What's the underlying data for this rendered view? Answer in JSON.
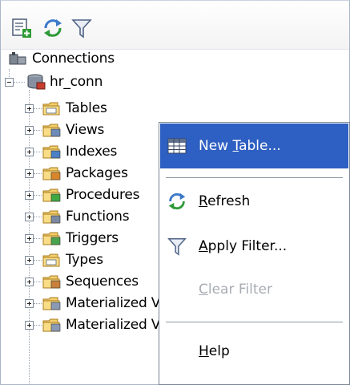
{
  "toolbar": {
    "buttons": [
      {
        "icon": "new-connection-icon"
      },
      {
        "icon": "refresh-icon"
      },
      {
        "icon": "filter-icon"
      }
    ]
  },
  "tree": {
    "root_label": "Connections",
    "connection_label": "hr_conn",
    "nodes": [
      {
        "label": "Tables",
        "icon": "tables-folder-icon"
      },
      {
        "label": "Views",
        "icon": "views-folder-icon"
      },
      {
        "label": "Indexes",
        "icon": "indexes-folder-icon"
      },
      {
        "label": "Packages",
        "icon": "packages-folder-icon"
      },
      {
        "label": "Procedures",
        "icon": "procedures-folder-icon"
      },
      {
        "label": "Functions",
        "icon": "functions-folder-icon"
      },
      {
        "label": "Triggers",
        "icon": "triggers-folder-icon"
      },
      {
        "label": "Types",
        "icon": "types-folder-icon"
      },
      {
        "label": "Sequences",
        "icon": "sequences-folder-icon"
      },
      {
        "label": "Materialized Views",
        "icon": "materialized-views-folder-icon"
      },
      {
        "label": "Materialized View Logs",
        "icon": "materialized-view-logs-folder-icon"
      }
    ]
  },
  "context_menu": {
    "items": [
      {
        "pre": "New ",
        "mnemonic": "T",
        "post": "able...",
        "state": "active",
        "icon": "table-grid-icon"
      },
      {
        "pre": "",
        "mnemonic": "R",
        "post": "efresh",
        "state": "enabled",
        "icon": "refresh-icon"
      },
      {
        "pre": "",
        "mnemonic": "A",
        "post": "pply Filter...",
        "state": "enabled",
        "icon": "filter-icon"
      },
      {
        "pre": "",
        "mnemonic": "C",
        "post": "lear Filter",
        "state": "disabled",
        "icon": ""
      },
      {
        "pre": "",
        "mnemonic": "H",
        "post": "elp",
        "state": "enabled",
        "icon": ""
      }
    ]
  },
  "colors": {
    "highlight": "#2e5fc2",
    "disabled_text": "#a8acb3",
    "folder": "#f3cf6d"
  }
}
